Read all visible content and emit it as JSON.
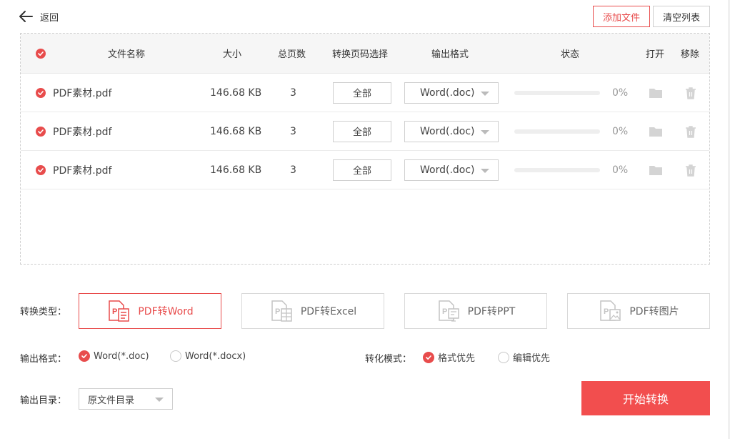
{
  "header": {
    "back_label": "返回",
    "add_file_label": "添加文件",
    "clear_list_label": "清空列表"
  },
  "table": {
    "columns": {
      "name": "文件名称",
      "size": "大小",
      "pages": "总页数",
      "page_select": "转换页码选择",
      "format": "输出格式",
      "status": "状态",
      "open": "打开",
      "remove": "移除"
    },
    "rows": [
      {
        "name": "PDF素材.pdf",
        "size": "146.68 KB",
        "pages": "3",
        "page_select": "全部",
        "format": "Word(.doc)",
        "percent": "0%",
        "progress": 0
      },
      {
        "name": "PDF素材.pdf",
        "size": "146.68 KB",
        "pages": "3",
        "page_select": "全部",
        "format": "Word(.doc)",
        "percent": "0%",
        "progress": 0
      },
      {
        "name": "PDF素材.pdf",
        "size": "146.68 KB",
        "pages": "3",
        "page_select": "全部",
        "format": "Word(.doc)",
        "percent": "0%",
        "progress": 0
      }
    ]
  },
  "conversion": {
    "type_label": "转换类型：",
    "types": [
      {
        "label": "PDF转Word",
        "icon": "pdf-word-icon",
        "active": true
      },
      {
        "label": "PDF转Excel",
        "icon": "pdf-excel-icon",
        "active": false
      },
      {
        "label": "PDF转PPT",
        "icon": "pdf-ppt-icon",
        "active": false
      },
      {
        "label": "PDF转图片",
        "icon": "pdf-image-icon",
        "active": false
      }
    ],
    "format_label": "输出格式：",
    "format_options": [
      {
        "label": "Word(*.doc)",
        "selected": true
      },
      {
        "label": "Word(*.docx)",
        "selected": false
      }
    ],
    "mode_label": "转化模式：",
    "mode_options": [
      {
        "label": "格式优先",
        "selected": true
      },
      {
        "label": "编辑优先",
        "selected": false
      }
    ],
    "dir_label": "输出目录：",
    "dir_value": "原文件目录",
    "start_label": "开始转换"
  },
  "colors": {
    "accent": "#e84c4c",
    "start_button": "#f24e4e",
    "border": "#cfcfcf",
    "header_bg": "#f6f6f6"
  }
}
